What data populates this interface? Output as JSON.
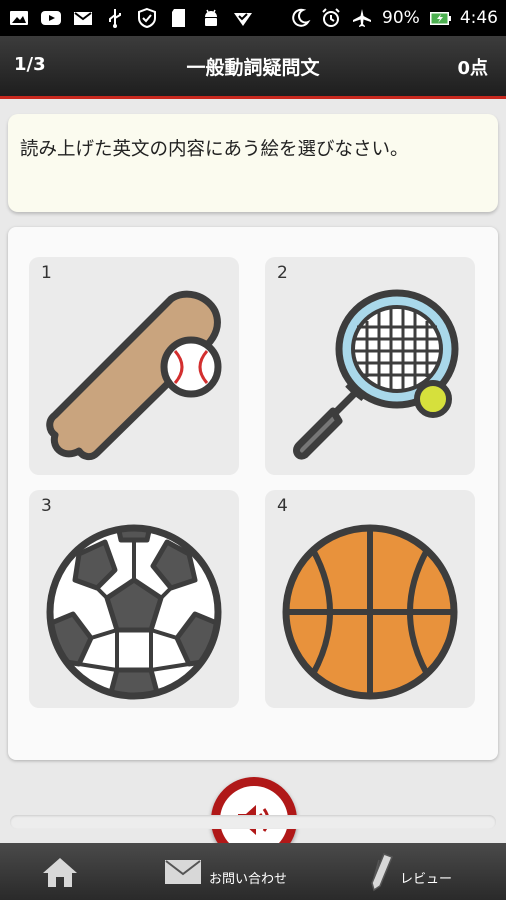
{
  "statusbar": {
    "battery": "90%",
    "time": "4:46",
    "icons": [
      "image-icon",
      "youtube-icon",
      "gmail-icon",
      "usb-icon",
      "shield-icon",
      "sd-card-icon",
      "android-icon",
      "wifi-check-icon",
      "moon-icon",
      "alarm-icon",
      "airplane-icon",
      "battery-icon"
    ]
  },
  "header": {
    "progress": "1/3",
    "title": "一般動詞疑問文",
    "score": "0点"
  },
  "question": {
    "text": "読み上げた英文の内容にあう絵を選びなさい。"
  },
  "choices": [
    {
      "number": "1",
      "icon": "baseball-bat-icon"
    },
    {
      "number": "2",
      "icon": "tennis-racket-icon"
    },
    {
      "number": "3",
      "icon": "soccer-ball-icon"
    },
    {
      "number": "4",
      "icon": "basketball-icon"
    }
  ],
  "player": {
    "icon": "speaker-icon"
  },
  "bottom_nav": {
    "home_icon": "home-icon",
    "contact_label": "お問い合わせ",
    "review_label": "レビュー"
  },
  "colors": {
    "accent": "#c8281e",
    "speaker": "#b01818",
    "header": "#2a2a2a"
  }
}
